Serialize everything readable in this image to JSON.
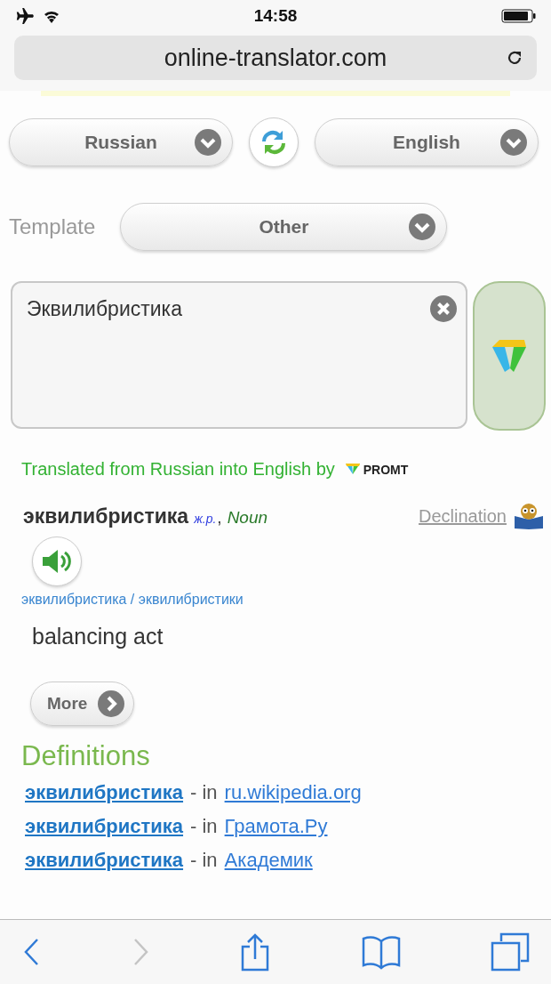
{
  "status_bar": {
    "time": "14:58"
  },
  "address_bar": {
    "url": "online-translator.com"
  },
  "languages": {
    "from": "Russian",
    "to": "English"
  },
  "template": {
    "label": "Template",
    "value": "Other"
  },
  "input": {
    "value": "Эквилибристика"
  },
  "credit": {
    "text": "Translated from Russian into English by",
    "brand": "PROMT"
  },
  "entry": {
    "headword": "эквилибристика",
    "gender": "ж.р.",
    "separator": ",",
    "pos": "Noun",
    "declination": "Declination",
    "forms": "эквилибристика / эквилибристики",
    "translation": "balancing act",
    "more": "More"
  },
  "definitions": {
    "heading": "Definitions",
    "items": [
      {
        "word": "эквилибристика",
        "connector": "- in",
        "source": "ru.wikipedia.org"
      },
      {
        "word": "эквилибристика",
        "connector": "- in",
        "source": "Грамота.Ру"
      },
      {
        "word": "эквилибристика",
        "connector": "- in",
        "source": "Академик"
      }
    ]
  },
  "toolbar": {
    "back_disabled": false,
    "forward_disabled": true
  }
}
